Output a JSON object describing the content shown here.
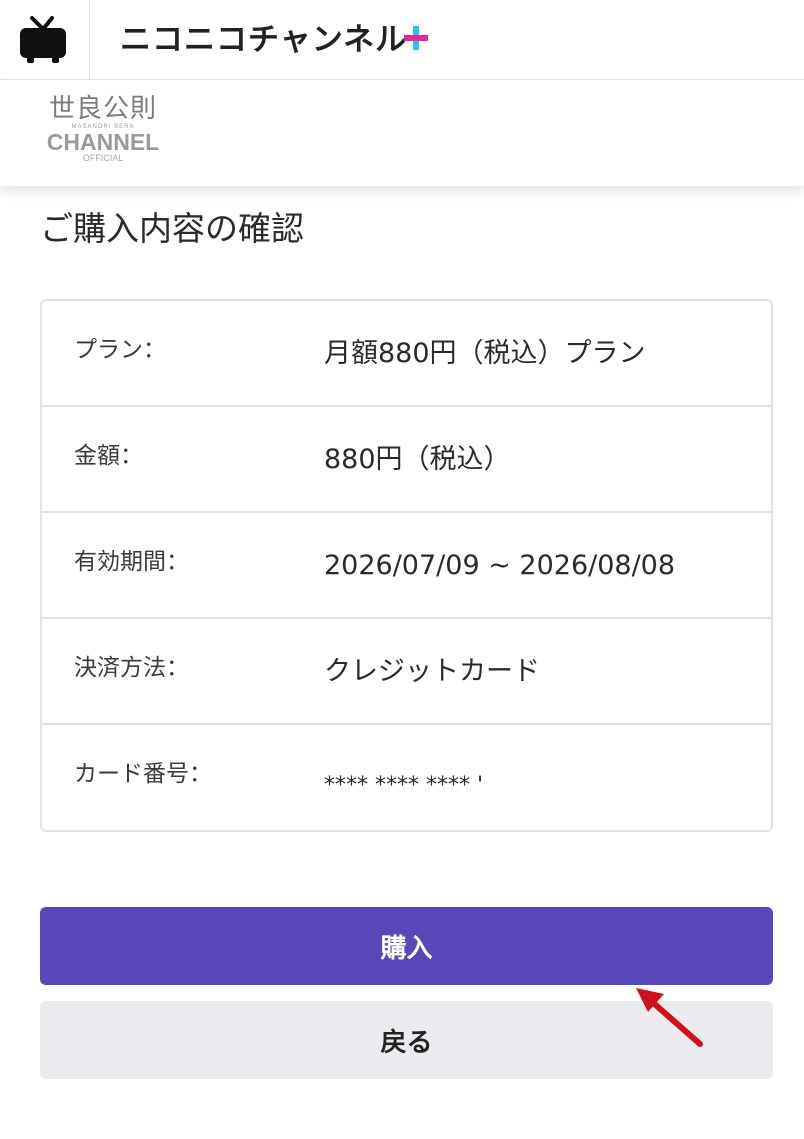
{
  "header": {
    "brand_name": "ニコニコチャンネル",
    "brand_plus": "+",
    "tv_icon": "niconico-tv-icon"
  },
  "channel_logo": {
    "kanji": "世良公則",
    "romaji": "MASANORI SERA",
    "channel_word": "CHANNEL",
    "official": "OFFICIAL"
  },
  "page": {
    "title": "ご購入内容の確認"
  },
  "summary": {
    "rows": [
      {
        "label": "プラン：",
        "value": "月額880円（税込）プラン"
      },
      {
        "label": "金額：",
        "value": "880円（税込）"
      },
      {
        "label": "有効期間：",
        "value": "2026/07/09 ~ 2026/08/08"
      },
      {
        "label": "決済方法：",
        "value": "クレジットカード"
      },
      {
        "label": "カード番号：",
        "value": "**** **** **** '"
      }
    ]
  },
  "actions": {
    "purchase_label": "購入",
    "back_label": "戻る"
  },
  "colors": {
    "primary": "#5747b9",
    "secondary_bg": "#ebebef",
    "plus_cyan": "#27c2e8",
    "plus_magenta": "#e8259a",
    "annotation_arrow": "#d0101a"
  },
  "annotation": {
    "icon": "red-arrow-icon"
  }
}
